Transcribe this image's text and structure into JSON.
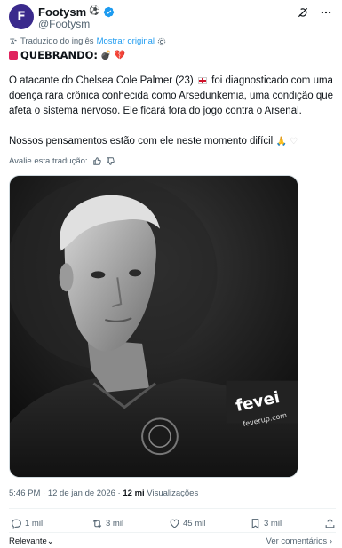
{
  "account": {
    "name": "Footysm",
    "handle": "@Footysm",
    "avatar_letter": "F"
  },
  "translation": {
    "note": "Traduzido do inglês",
    "show_original": "Mostrar original"
  },
  "tweet": {
    "breaking_label": "QUEBRANDO:",
    "paragraph1_a": "O atacante do Chelsea Cole Palmer (23)",
    "paragraph1_b": "foi diagnosticado com uma doença rara crônica conhecida como Arsedunkemia, uma condição que afeta o sistema nervoso. Ele ficará fora do jogo contra o Arsenal.",
    "paragraph2": "Nossos pensamentos estão com ele neste momento difícil"
  },
  "rate_translation": "Avalie esta tradução:",
  "photo": {
    "sponsor_text": "fevei",
    "sponsor_sub": "feverup.com"
  },
  "meta": {
    "time": "5:46 PM",
    "date": "· 12 de jan de 2026 ·",
    "views_count": "12 mi",
    "views_label": "Visualizações"
  },
  "actions": {
    "replies": "1 mil",
    "reposts": "3 mil",
    "likes": "45 mil",
    "bookmarks": "3 mil"
  },
  "footer": {
    "sort_label": "Relevante",
    "view_comments": "Ver comentários"
  },
  "colors": {
    "accent": "#1d9bf0",
    "avatar_bg": "#3a2a8c",
    "text": "#0f1419",
    "secondary": "#536471"
  }
}
